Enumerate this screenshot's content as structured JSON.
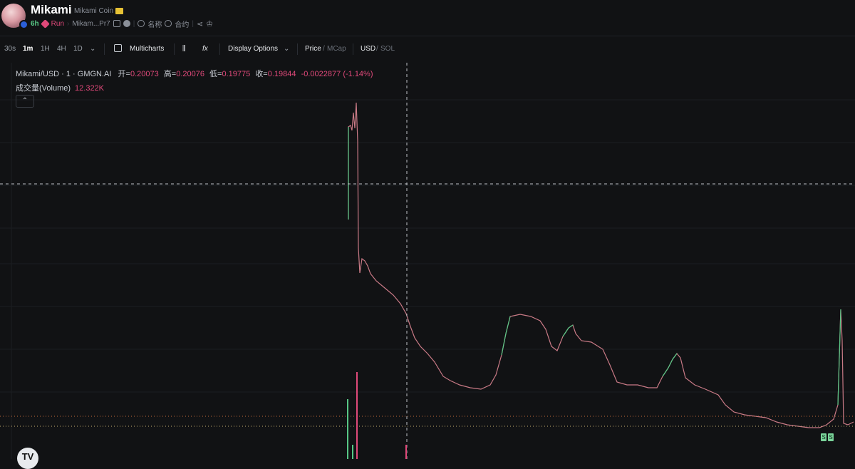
{
  "header": {
    "token_name": "Mikami",
    "token_fullname": "Mikami Coin",
    "age": "6h",
    "status": "Run",
    "address_short": "Mikam...Pr7",
    "search_label": "名称",
    "contract_label": "合约"
  },
  "toolbar": {
    "intervals": [
      "30s",
      "1m",
      "1H",
      "4H",
      "1D"
    ],
    "active_interval": "1m",
    "multicharts": "Multicharts",
    "display_options": "Display Options",
    "price": "Price",
    "mcap": "MCap",
    "usd": "USD",
    "sol": "SOL"
  },
  "legend": {
    "pair": "Mikami/USD · 1 · GMGN.AI",
    "open_label": "开=",
    "open": "0.20073",
    "high_label": "高=",
    "high": "0.20076",
    "low_label": "低=",
    "low": "0.19775",
    "close_label": "收=",
    "close": "0.19844",
    "change": "-0.0022877",
    "change_pct": "(-1.14%)",
    "volume_label": "成交量(Volume)",
    "volume_value": "12.322K"
  },
  "trade_tags": [
    "S",
    "S"
  ],
  "logo_text": "TV",
  "colors": {
    "background": "#111214",
    "grid": "#1c1e22",
    "up": "#57c785",
    "down": "#e0497a",
    "crosshair": "#bfc3c9",
    "price_line": "#c46a3a"
  },
  "chart_data": {
    "type": "line",
    "price_series_trace": [
      0.0,
      0.0,
      0.0,
      0.0,
      0.0
    ],
    "note_free": true
  }
}
